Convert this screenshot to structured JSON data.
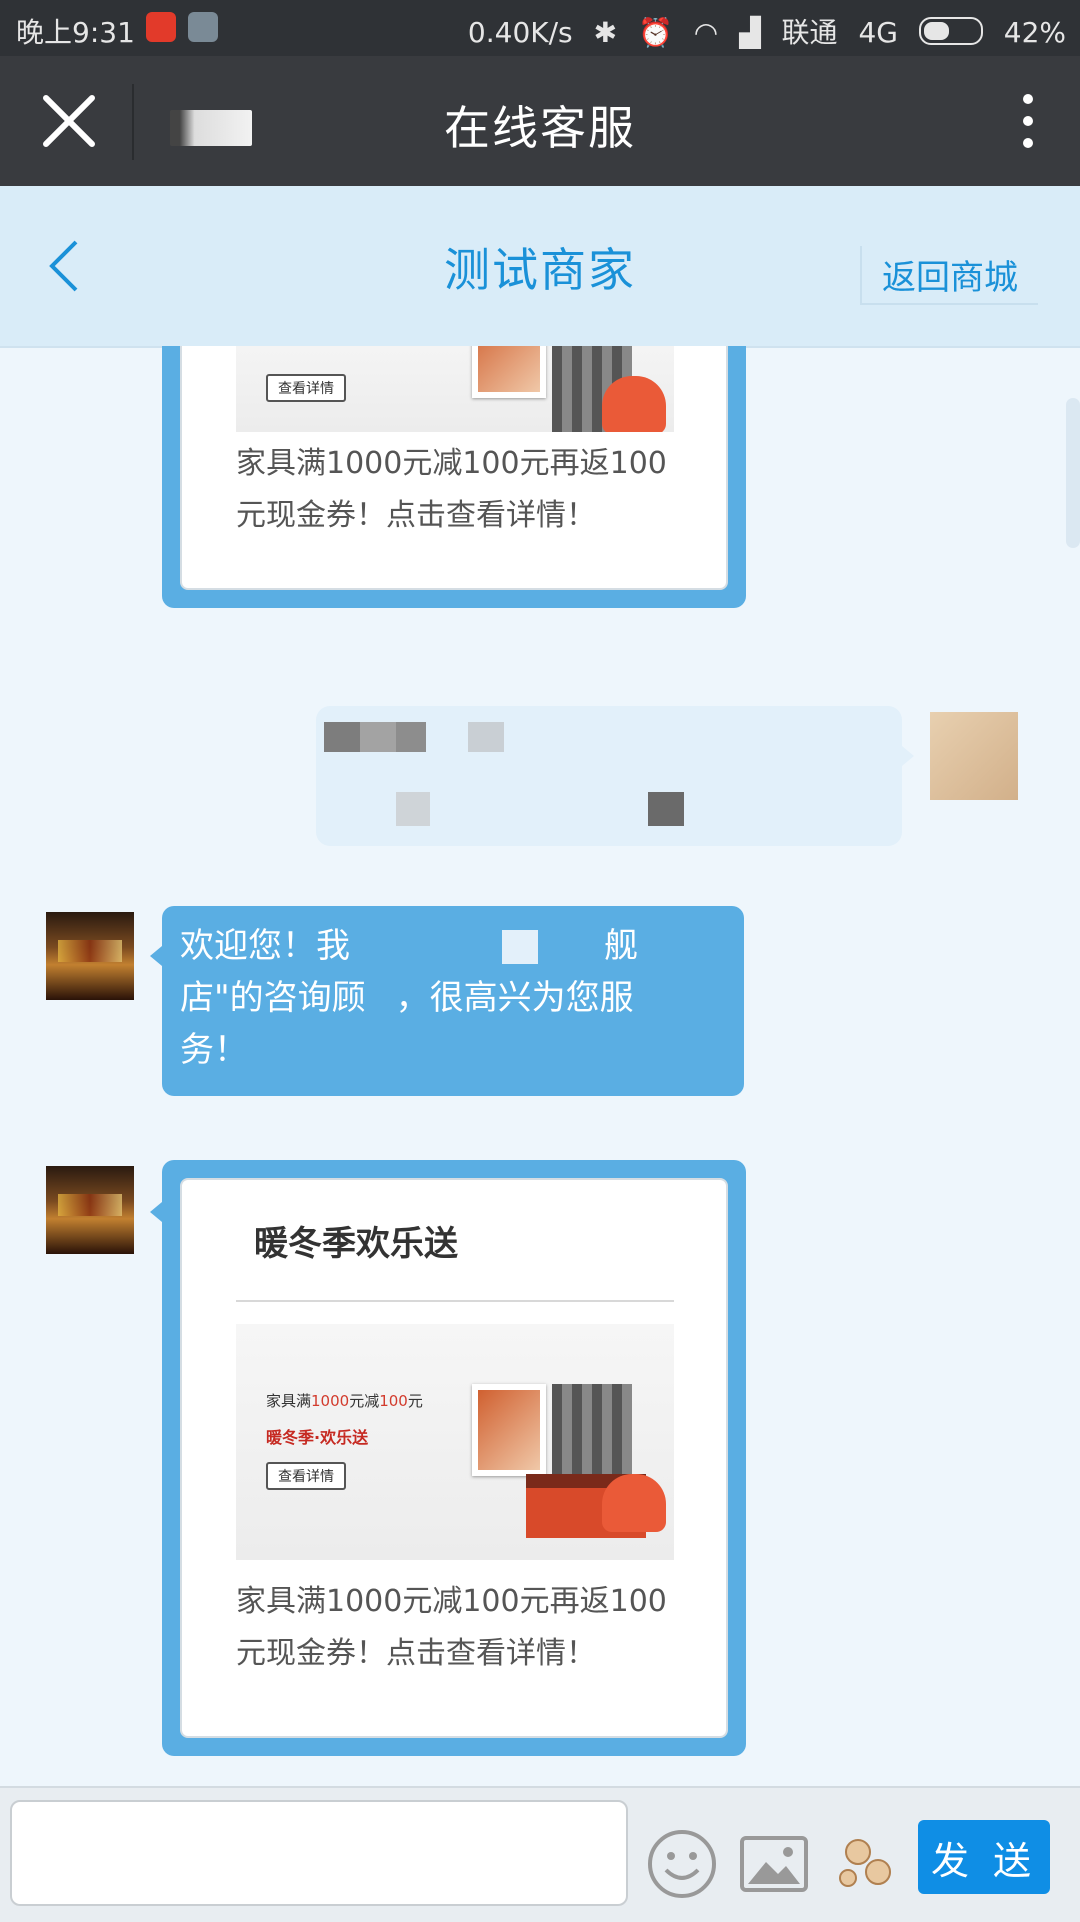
{
  "status_bar": {
    "time": "晚上9:31",
    "network_speed": "0.40K/s",
    "carrier": "联通",
    "network_type": "4G",
    "battery": "42%"
  },
  "title_bar": {
    "title": "在线客服"
  },
  "shop_header": {
    "title": "测试商家",
    "return_label": "返回商城"
  },
  "messages": {
    "promo_top": {
      "button_text": "查看详情",
      "description": "家具满1000元减100元再返100元现金券！点击查看详情！"
    },
    "welcome": {
      "text_line1": "欢迎您！我",
      "text_line1_end": "舰",
      "text_line2_start": "店\"的咨询顾",
      "text_line2_end": "，很高兴为您服",
      "text_line3": "务！"
    },
    "promo_card": {
      "title": "暖冬季欢乐送",
      "img_line1_prefix": "家具满",
      "img_line1_amount1": "1000",
      "img_line1_mid": "元减",
      "img_line1_amount2": "100",
      "img_line1_suffix": "元",
      "img_line2": "暖冬季·欢乐送",
      "button_text": "查看详情",
      "description": "家具满1000元减100元再返100元现金券！点击查看详情！"
    }
  },
  "input_bar": {
    "message_value": "",
    "send_label": "发 送"
  },
  "colors": {
    "accent": "#1a91d8",
    "bubble": "#5aaee3",
    "send_button": "#0f8ee5",
    "title_bar": "#393b3f"
  }
}
